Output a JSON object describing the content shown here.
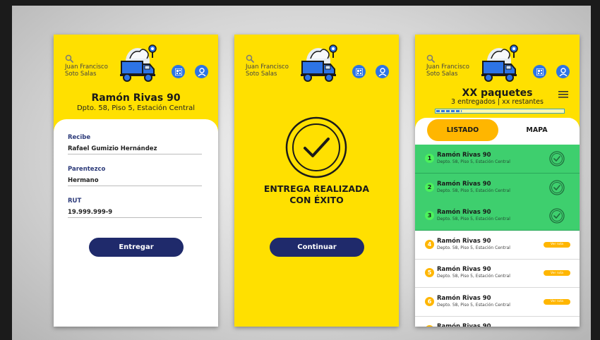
{
  "colors": {
    "accent_yellow": "#ffe000",
    "primary_button": "#1f2a6b",
    "success_green": "#3ecf6e",
    "pending_orange": "#ffb600",
    "icon_blue": "#2d74e6"
  },
  "header": {
    "user_name": "Juan Francisco Soto Salas",
    "icons": [
      "search-icon",
      "delivery-truck-logo",
      "qr-code-icon",
      "user-profile-icon"
    ]
  },
  "delivery_form": {
    "address_title": "Ramón Rivas 90",
    "address_sub": "Dpto. 58, Piso 5, Estación Central",
    "fields": [
      {
        "label": "Recibe",
        "value": "Rafael Gumizio Hernández"
      },
      {
        "label": "Parentezco",
        "value": "Hermano"
      },
      {
        "label": "RUT",
        "value": "19.999.999-9"
      }
    ],
    "submit_label": "Entregar"
  },
  "success_screen": {
    "line1": "ENTREGA REALIZADA",
    "line2": "CON ÉXITO",
    "continue_label": "Continuar"
  },
  "package_list": {
    "title": "XX paquetes",
    "subtitle": "3 entregados | xx restantes",
    "progress": 0.2,
    "tabs": {
      "list": "LISTADO",
      "map": "MAPA"
    },
    "items": [
      {
        "num": "1",
        "title": "Ramón Rivas 90",
        "sub": "Depto. 58, Piso 5, Estación Central",
        "status": "done"
      },
      {
        "num": "2",
        "title": "Ramón Rivas 90",
        "sub": "Depto. 58, Piso 5, Estación Central",
        "status": "done"
      },
      {
        "num": "3",
        "title": "Ramón Rivas 90",
        "sub": "Depto. 58, Piso 5, Estación Central",
        "status": "done"
      },
      {
        "num": "4",
        "title": "Ramón Rivas 90",
        "sub": "Depto. 58, Piso 5, Estación Central",
        "status": "pending",
        "badge": "Ver ruta"
      },
      {
        "num": "5",
        "title": "Ramón Rivas 90",
        "sub": "Depto. 58, Piso 5, Estación Central",
        "status": "pending",
        "badge": "Ver ruta"
      },
      {
        "num": "6",
        "title": "Ramón Rivas 90",
        "sub": "Depto. 58, Piso 5, Estación Central",
        "status": "pending",
        "badge": "Ver ruta"
      },
      {
        "num": "7",
        "title": "Ramón Rivas 90",
        "sub": "",
        "status": "pending",
        "badge": ""
      }
    ]
  }
}
